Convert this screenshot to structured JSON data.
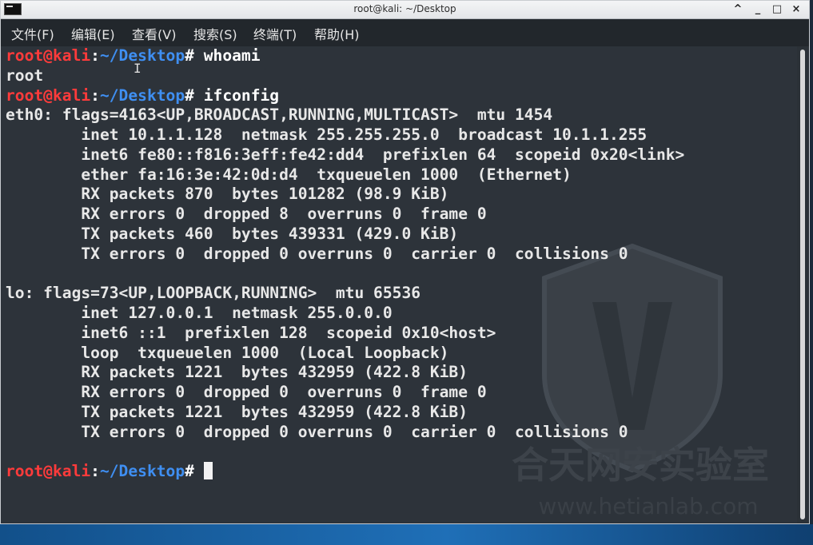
{
  "window": {
    "title": "root@kali: ~/Desktop",
    "controls": [
      "^",
      "_",
      "□",
      "×"
    ]
  },
  "menubar": {
    "items": [
      "文件(F)",
      "编辑(E)",
      "查看(V)",
      "搜索(S)",
      "终端(T)",
      "帮助(H)"
    ]
  },
  "terminal": {
    "prompt_user": "root@kali",
    "prompt_colon": ":",
    "prompt_path": "~/Desktop",
    "prompt_symbol": "# ",
    "cmd1": "whoami",
    "out_root": "root",
    "cmd2": "ifconfig",
    "eth0": [
      "eth0: flags=4163<UP,BROADCAST,RUNNING,MULTICAST>  mtu 1454",
      "        inet 10.1.1.128  netmask 255.255.255.0  broadcast 10.1.1.255",
      "        inet6 fe80::f816:3eff:fe42:dd4  prefixlen 64  scopeid 0x20<link>",
      "        ether fa:16:3e:42:0d:d4  txqueuelen 1000  (Ethernet)",
      "        RX packets 870  bytes 101282 (98.9 KiB)",
      "        RX errors 0  dropped 8  overruns 0  frame 0",
      "        TX packets 460  bytes 439331 (429.0 KiB)",
      "        TX errors 0  dropped 0 overruns 0  carrier 0  collisions 0"
    ],
    "lo": [
      "lo: flags=73<UP,LOOPBACK,RUNNING>  mtu 65536",
      "        inet 127.0.0.1  netmask 255.0.0.0",
      "        inet6 ::1  prefixlen 128  scopeid 0x10<host>",
      "        loop  txqueuelen 1000  (Local Loopback)",
      "        RX packets 1221  bytes 432959 (422.8 KiB)",
      "        RX errors 0  dropped 0  overruns 0  frame 0",
      "        TX packets 1221  bytes 432959 (422.8 KiB)",
      "        TX errors 0  dropped 0 overruns 0  carrier 0  collisions 0"
    ]
  },
  "watermark": {
    "text": "合天网安实验室",
    "url": "www.hetianlab.com"
  },
  "colors": {
    "prompt_user": "#ff3b3b",
    "prompt_path": "#3f8ff2",
    "terminal_bg": "#2d333a"
  }
}
